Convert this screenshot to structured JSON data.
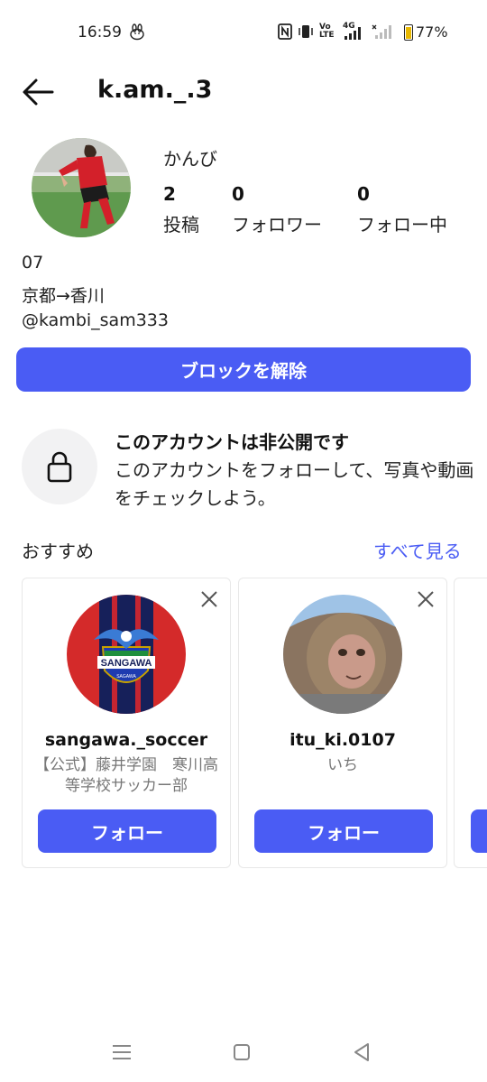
{
  "status_bar": {
    "time": "16:59",
    "icons": [
      "nfc-icon",
      "vibrate-icon",
      "volte-icon",
      "4g-signal-icon",
      "signal-icon"
    ],
    "volte_label": "Vo\nLTE",
    "network_label": "4G",
    "battery_percent": "77%",
    "battery_level": 0.77
  },
  "header": {
    "username": "k.am._.3"
  },
  "profile": {
    "display_name": "かんび",
    "stats": [
      {
        "count": "2",
        "label": "投稿"
      },
      {
        "count": "0",
        "label": "フォロワー"
      },
      {
        "count": "0",
        "label": "フォロー中"
      }
    ],
    "bio_lines": [
      "07",
      "京都→香川",
      "@kambi_sam333"
    ]
  },
  "actions": {
    "unblock_label": "ブロックを解除"
  },
  "private": {
    "title": "このアカウントは非公開です",
    "description": "このアカウントをフォローして、写真や動画をチェックしよう。"
  },
  "suggestions": {
    "label": "おすすめ",
    "see_all": "すべて見る",
    "cards": [
      {
        "name": "sangawa._soccer",
        "desc": "【公式】藤井学園　寒川高等学校サッカー部",
        "follow": "フォロー",
        "logo_text": "SANGAWA",
        "logo_sub": "SAGAWA"
      },
      {
        "name": "itu_ki.0107",
        "desc": "いち",
        "follow": "フォロー"
      }
    ]
  },
  "colors": {
    "accent": "#4a5cf4",
    "secondary_text": "#777777"
  }
}
